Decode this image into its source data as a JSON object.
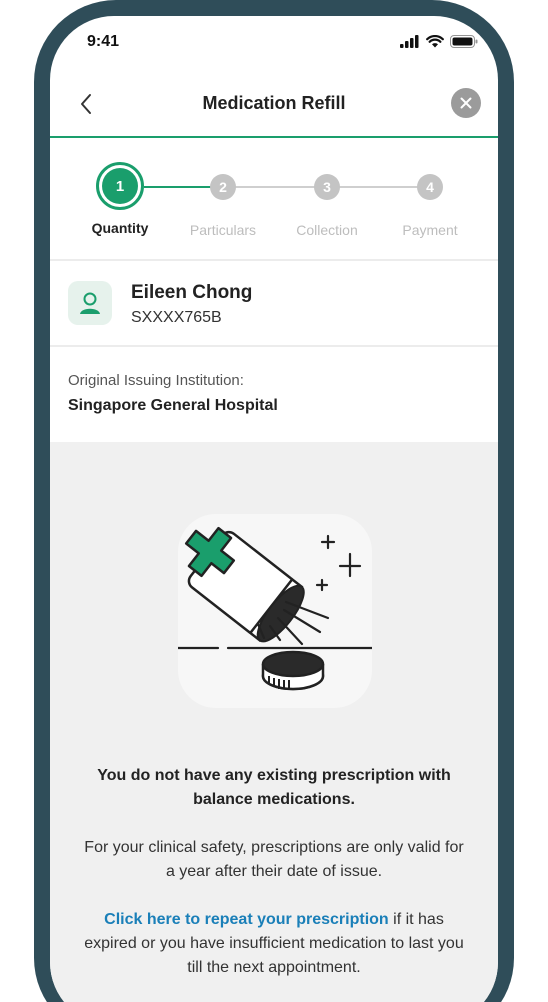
{
  "status_bar": {
    "time": "9:41"
  },
  "header": {
    "title": "Medication Refill"
  },
  "stepper": {
    "steps": [
      {
        "number": "1",
        "label": "Quantity"
      },
      {
        "number": "2",
        "label": "Particulars"
      },
      {
        "number": "3",
        "label": "Collection"
      },
      {
        "number": "4",
        "label": "Payment"
      }
    ]
  },
  "patient": {
    "name": "Eileen Chong",
    "id": "SXXXX765B"
  },
  "institution": {
    "label": "Original Issuing Institution:",
    "value": "Singapore General Hospital"
  },
  "empty_state": {
    "title": "You do not have any existing prescription with balance medications.",
    "body": "For your clinical safety, prescriptions are only valid for a year after their date of issue.",
    "link_text": "Click here to repeat your prescription",
    "link_suffix": " if it has expired or you have insufficient medication to last you till the next appointment."
  },
  "colors": {
    "accent": "#1a9e6c",
    "link": "#1a7fb8",
    "frame": "#2f4d59",
    "panel": "#f0f0f0"
  }
}
